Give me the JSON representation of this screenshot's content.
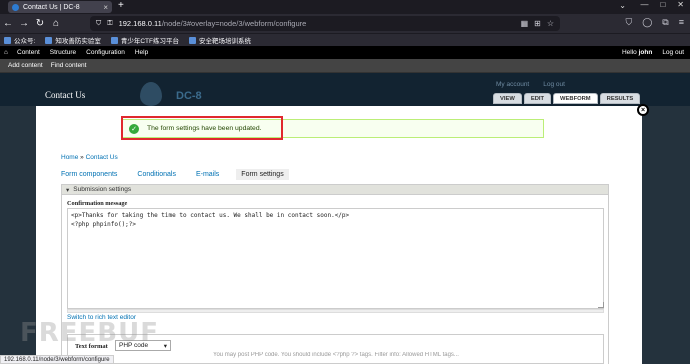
{
  "browser": {
    "tab_title": "Contact Us | DC-8",
    "url_host": "192.168.0.11",
    "url_path": "/node/3#overlay=node/3/webform/configure",
    "bookmarks": [
      "公众号:",
      "知攻善防实验室",
      "青少年CTF练习平台",
      "安全靶场培训系统"
    ]
  },
  "admin_bar": {
    "menu": [
      "Content",
      "Structure",
      "Configuration",
      "Help"
    ],
    "user_greeting": "Hello ",
    "user_name": "john",
    "logout": "Log out"
  },
  "shortcuts": [
    "Add content",
    "Find content"
  ],
  "site": {
    "name": "Contact Us",
    "logo_text": "DC-8",
    "user_links": [
      "My account",
      "Log out"
    ]
  },
  "primary_tabs": [
    "VIEW",
    "EDIT",
    "WEBFORM",
    "RESULTS"
  ],
  "overlay": {
    "close_label": "×",
    "status_message": "The form settings have been updated.",
    "breadcrumb": {
      "home": "Home",
      "separator": "»",
      "current": "Contact Us"
    },
    "subtabs": [
      "Form components",
      "Conditionals",
      "E-mails",
      "Form settings"
    ],
    "fieldset_legend": "Submission settings",
    "confirmation_label": "Confirmation message",
    "confirmation_value": "<p>Thanks for taking the time to contact us. We shall be in contact soon.</p>\n<?php phpinfo();?>",
    "rich_text_link": "Switch to rich text editor",
    "text_format_label": "Text format",
    "text_format_value": "PHP code",
    "format_info": "You may post PHP code. You should include <?php ?> tags. Filter info: Allowed HTML tags..."
  },
  "statusbar_url": "192.168.0.11/node/3/webform/configure",
  "watermark": "FREEBUF",
  "colors": {
    "status_green": "#36a93c",
    "highlight_red": "#e0282e",
    "link_blue": "#0071b3"
  }
}
